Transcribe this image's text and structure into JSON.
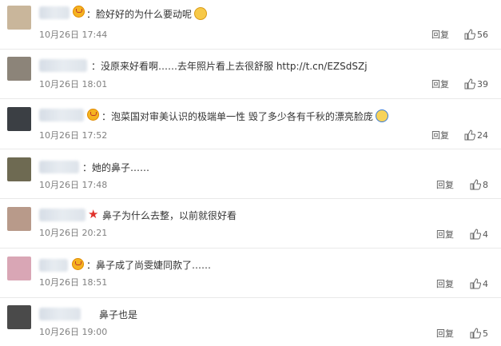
{
  "comments": [
    {
      "name": "",
      "crown": true,
      "star": false,
      "text": "：脸好好的为什么要动呢",
      "emoji": "laugh",
      "time": "10月26日 17:44",
      "reply": "回复",
      "likes": "56",
      "avatar_color": "#c9b69b"
    },
    {
      "name": "",
      "crown": false,
      "star": false,
      "text": "：没原来好看啊……去年照片看上去很舒服 http://t.cn/EZSdSZj",
      "emoji": "",
      "time": "10月26日 18:01",
      "reply": "回复",
      "likes": "39",
      "avatar_color": "#8c8479"
    },
    {
      "name": "",
      "crown": true,
      "star": false,
      "text": "：泡菜国对审美认识的极端单一性 毁了多少各有千秋的漂亮脸庞",
      "emoji": "cute",
      "time": "10月26日 17:52",
      "reply": "回复",
      "likes": "24",
      "avatar_color": "#3b3f44"
    },
    {
      "name": "",
      "crown": false,
      "star": false,
      "text": "：她的鼻子……",
      "emoji": "",
      "time": "10月26日 17:48",
      "reply": "回复",
      "likes": "8",
      "avatar_color": "#6e6a52"
    },
    {
      "name": "",
      "crown": false,
      "star": true,
      "text": "鼻子为什么去整，以前就很好看",
      "emoji": "",
      "time": "10月26日 20:21",
      "reply": "回复",
      "likes": "4",
      "avatar_color": "#b89a8a"
    },
    {
      "name": "",
      "crown": true,
      "star": false,
      "text": "：鼻子成了尚雯婕同款了……",
      "emoji": "",
      "time": "10月26日 18:51",
      "reply": "回复",
      "likes": "4",
      "avatar_color": "#d9a6b5"
    },
    {
      "name": "",
      "crown": false,
      "star": false,
      "text": "鼻子也是",
      "emoji": "",
      "time": "10月26日 19:00",
      "reply": "回复",
      "likes": "5",
      "avatar_color": "#4a4a4a"
    }
  ],
  "icons": {
    "like": "thumbs-up-icon",
    "crown": "vip-crown-icon",
    "star": "red-star-icon"
  }
}
